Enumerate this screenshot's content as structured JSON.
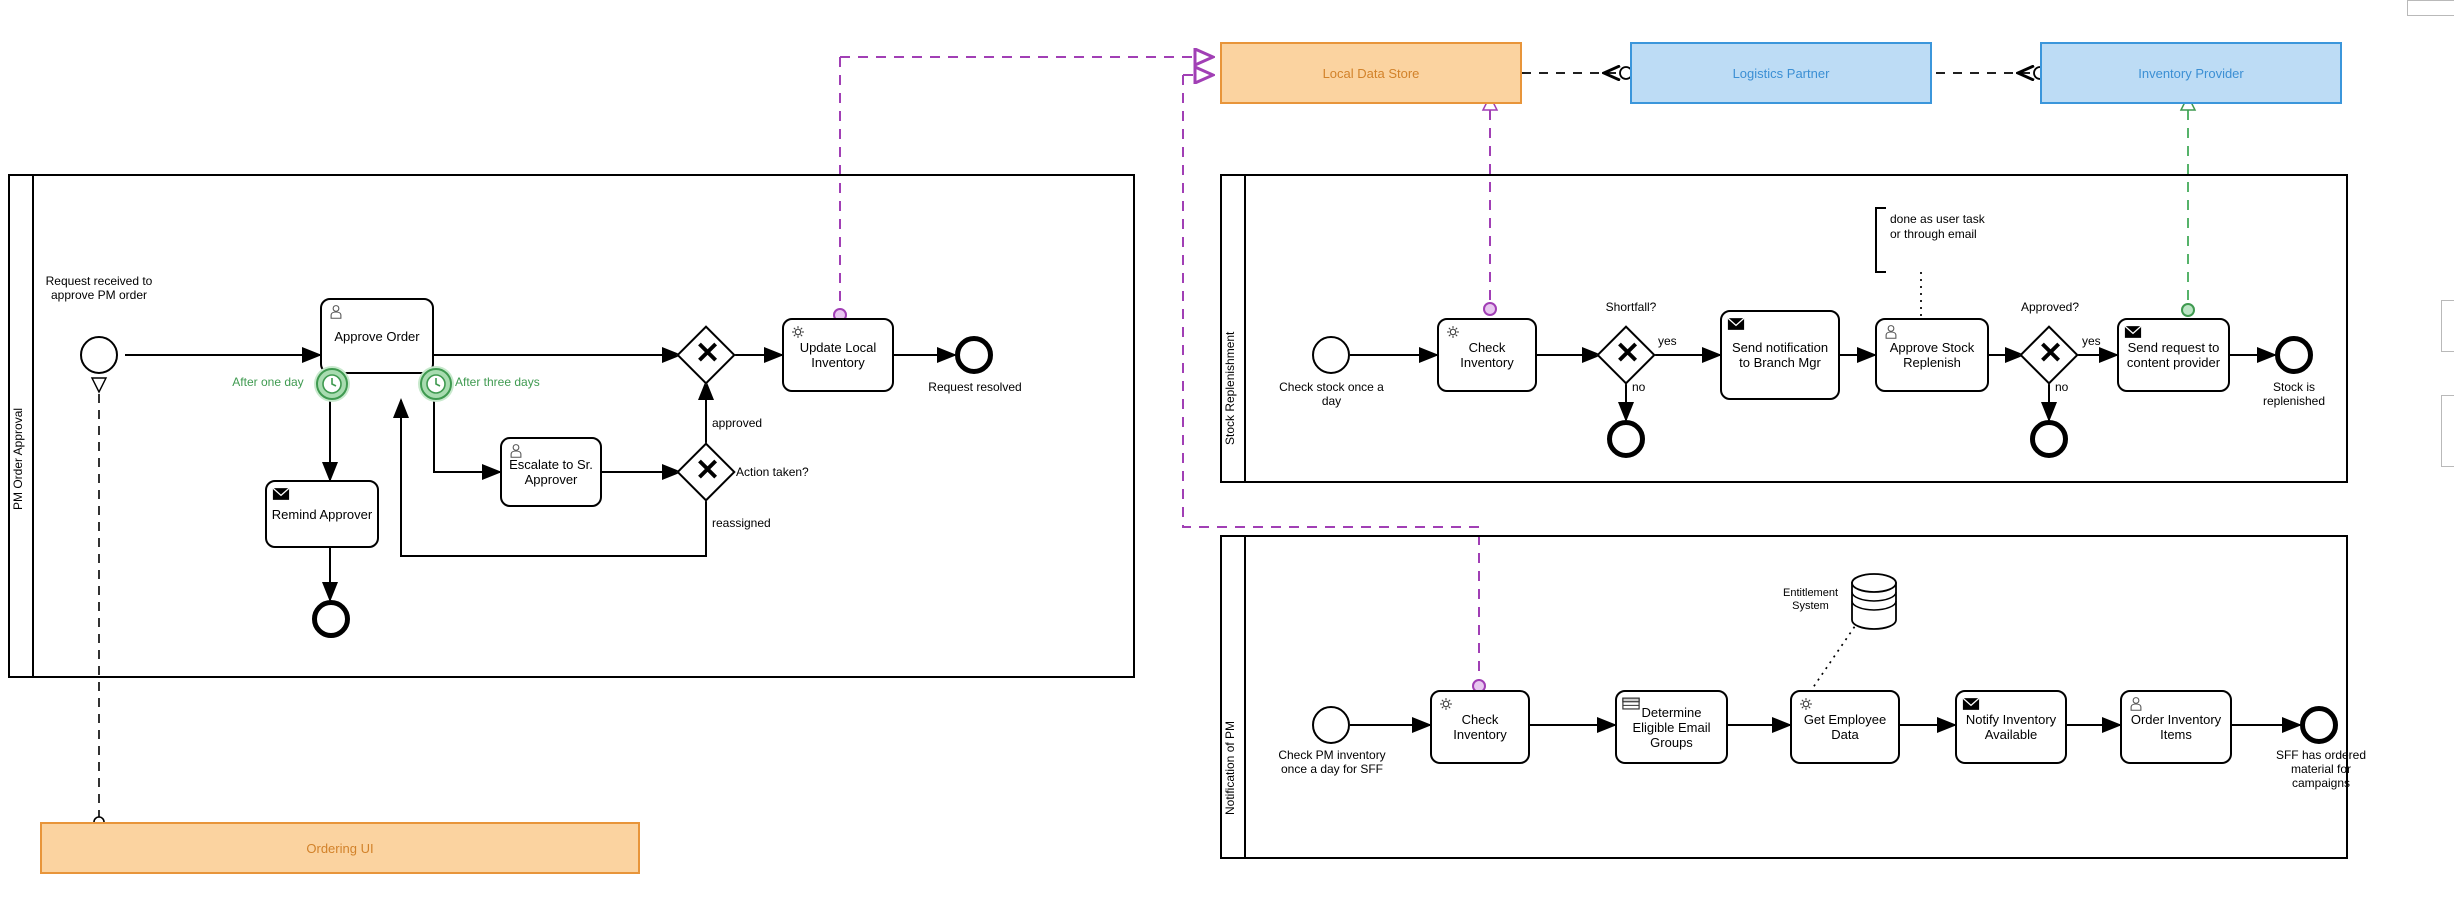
{
  "diagram": {
    "title": "PM Order Approval / Stock Replenishment / Notification of PM BPMN",
    "colors": {
      "orange_fill": "#fbd3a0",
      "orange_stroke": "#e8953a",
      "orange_text": "#d2822a",
      "blue_fill": "#bddcf5",
      "blue_stroke": "#3b96db",
      "blue_text": "#3b8fd4",
      "green_accent": "#3f9a50",
      "purple_flow": "#a13fb5",
      "black": "#000000"
    }
  },
  "external": {
    "local_data_store": "Local Data Store",
    "logistics_partner": "Logistics Partner",
    "inventory_provider": "Inventory Provider",
    "ordering_ui": "Ordering UI"
  },
  "pools": [
    {
      "id": "pm-order-approval",
      "lane_label": "PM Order Approval",
      "nodes": [
        {
          "id": "start-1",
          "type": "start-event",
          "label": "Request received to approve PM order"
        },
        {
          "id": "approve-order",
          "type": "user-task",
          "label": "Approve Order",
          "icon": "user-icon"
        },
        {
          "id": "timer-1day",
          "type": "boundary-timer",
          "label": "After one day",
          "icon": "timer-icon"
        },
        {
          "id": "timer-3days",
          "type": "boundary-timer",
          "label": "After three days",
          "icon": "timer-icon"
        },
        {
          "id": "remind-approver",
          "type": "send-task",
          "label": "Remind Approver",
          "icon": "envelope-icon"
        },
        {
          "id": "escalate-sr",
          "type": "user-task",
          "label": "Escalate to Sr. Approver",
          "icon": "user-icon"
        },
        {
          "id": "end-remind",
          "type": "end-event",
          "label": ""
        },
        {
          "id": "gw-merge",
          "type": "exclusive-gateway",
          "label": ""
        },
        {
          "id": "gw-action",
          "type": "exclusive-gateway",
          "label": "Action taken?"
        },
        {
          "id": "update-local-inventory",
          "type": "service-task",
          "label": "Update Local Inventory",
          "icon": "gear-icon"
        },
        {
          "id": "end-resolved",
          "type": "end-event",
          "label": "Request resolved"
        }
      ],
      "flow_labels": {
        "approved": "approved",
        "reassigned": "reassigned"
      }
    },
    {
      "id": "stock-replenishment",
      "lane_label": "Stock Replenishment",
      "nodes": [
        {
          "id": "sr-start",
          "type": "start-event",
          "label": "Check stock once a day"
        },
        {
          "id": "sr-check-inventory",
          "type": "service-task",
          "label": "Check Inventory",
          "icon": "gear-icon"
        },
        {
          "id": "sr-gw-shortfall",
          "type": "exclusive-gateway",
          "label": "Shortfall?"
        },
        {
          "id": "sr-end-no",
          "type": "end-event",
          "label": ""
        },
        {
          "id": "sr-send-notification",
          "type": "send-task",
          "label": "Send notification to Branch Mgr",
          "icon": "envelope-icon"
        },
        {
          "id": "sr-approve-stock",
          "type": "user-task",
          "label": "Approve Stock Replenish",
          "icon": "user-icon"
        },
        {
          "id": "sr-gw-approved",
          "type": "exclusive-gateway",
          "label": "Approved?"
        },
        {
          "id": "sr-end-not-approved",
          "type": "end-event",
          "label": ""
        },
        {
          "id": "sr-send-request",
          "type": "send-task",
          "label": "Send request to content provider",
          "icon": "envelope-icon"
        },
        {
          "id": "sr-end-replenished",
          "type": "end-event",
          "label": "Stock is replenished"
        }
      ],
      "annotation": "done as user task or through email",
      "flow_labels": {
        "yes1": "yes",
        "no1": "no",
        "yes2": "yes",
        "no2": "no"
      }
    },
    {
      "id": "notification-of-pm",
      "lane_label": "Notification of PM",
      "nodes": [
        {
          "id": "np-start",
          "type": "start-event",
          "label": "Check PM inventory once a day for SFF"
        },
        {
          "id": "np-check-inventory",
          "type": "service-task",
          "label": "Check Inventory",
          "icon": "gear-icon"
        },
        {
          "id": "np-determine-groups",
          "type": "business-rule-task",
          "label": "Determine Eligible Email Groups",
          "icon": "table-icon"
        },
        {
          "id": "np-get-employee-data",
          "type": "service-task",
          "label": "Get Employee Data",
          "icon": "gear-icon"
        },
        {
          "id": "np-notify-inventory",
          "type": "send-task",
          "label": "Notify Inventory Available",
          "icon": "envelope-icon"
        },
        {
          "id": "np-order-items",
          "type": "user-task",
          "label": "Order Inventory Items",
          "icon": "user-icon"
        },
        {
          "id": "np-end",
          "type": "end-event",
          "label": "SFF has ordered material for campaigns"
        }
      ],
      "data_store": "Entitlement System"
    }
  ]
}
